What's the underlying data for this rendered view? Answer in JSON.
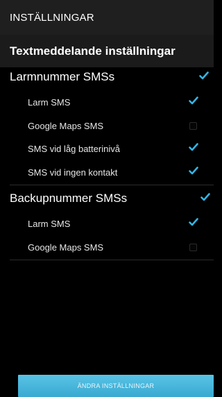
{
  "title_bar": {
    "title": "INSTÄLLNINGAR"
  },
  "subheader": {
    "title": "Textmeddelande inställningar"
  },
  "groups": [
    {
      "label": "Larmnummer SMSs",
      "checked": true,
      "items": [
        {
          "label": "Larm SMS",
          "checked": true
        },
        {
          "label": "Google Maps SMS",
          "checked": false
        },
        {
          "label": "SMS vid låg batterinivå",
          "checked": true
        },
        {
          "label": "SMS vid ingen kontakt",
          "checked": true
        }
      ]
    },
    {
      "label": "Backupnummer SMSs",
      "checked": true,
      "items": [
        {
          "label": "Larm SMS",
          "checked": true
        },
        {
          "label": "Google Maps SMS",
          "checked": false
        }
      ]
    }
  ],
  "bottom_button": {
    "label": "ÄNDRA INSTÄLLNINGAR"
  },
  "colors": {
    "accent": "#33b5e5",
    "button": "#4ab8de",
    "background": "#000000"
  },
  "icons": {
    "checked": "checkmark-icon",
    "unchecked": "empty-checkbox-icon"
  }
}
